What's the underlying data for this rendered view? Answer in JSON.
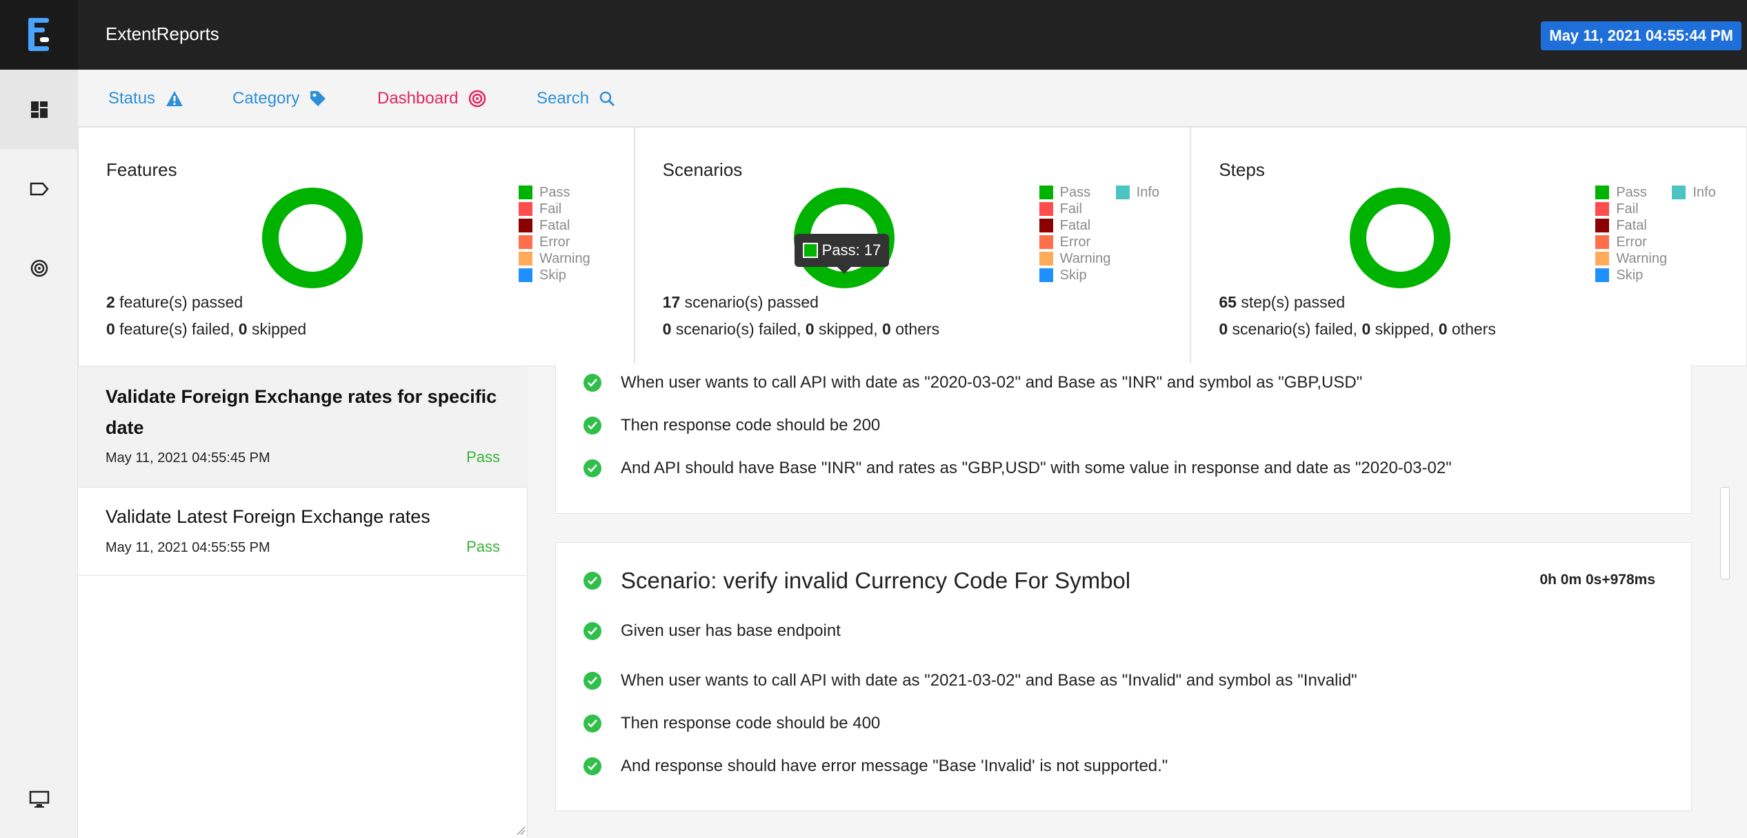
{
  "header": {
    "app_title": "ExtentReports",
    "timestamp": "May 11, 2021 04:55:44 PM",
    "logo_icon": "extent-logo-icon"
  },
  "sidebar": {
    "items": [
      {
        "icon": "dashboard-icon"
      },
      {
        "icon": "tag-icon"
      },
      {
        "icon": "target-icon"
      },
      {
        "icon": "monitor-icon"
      }
    ]
  },
  "nav": {
    "status": "Status",
    "category": "Category",
    "dashboard": "Dashboard",
    "search": "Search"
  },
  "legend_labels": {
    "pass": "Pass",
    "fail": "Fail",
    "fatal": "Fatal",
    "error": "Error",
    "warning": "Warning",
    "skip": "Skip",
    "info": "Info"
  },
  "colors": {
    "pass": "#00b300",
    "fail": "#ff4c4c",
    "fatal": "#8b0000",
    "error": "#ff6f4c",
    "warning": "#ffab59",
    "skip": "#1e90ff",
    "info": "#4cc4c4",
    "accent": "#1e6fd9",
    "status_pass_text": "#35b335"
  },
  "cards": {
    "features": {
      "title": "Features",
      "passed_count": "2",
      "passed_text": " feature(s) passed",
      "failed_count": "0",
      "failed_text": " feature(s) failed, ",
      "skipped_count": "0",
      "skipped_text": " skipped"
    },
    "scenarios": {
      "title": "Scenarios",
      "tooltip": "Pass: 17",
      "passed_count": "17",
      "passed_text": " scenario(s) passed",
      "failed_count": "0",
      "failed_text": " scenario(s) failed, ",
      "skipped_count": "0",
      "skipped_text": " skipped, ",
      "others_count": "0",
      "others_text": " others"
    },
    "steps": {
      "title": "Steps",
      "passed_count": "65",
      "passed_text": " step(s) passed",
      "failed_count": "0",
      "failed_text": " scenario(s) failed, ",
      "skipped_count": "0",
      "skipped_text": " skipped, ",
      "others_count": "0",
      "others_text": " others"
    }
  },
  "test_list": [
    {
      "title_line1": "Validate Foreign Exchange rates for specific",
      "title_line2": "date",
      "date": "May 11, 2021 04:55:45 PM",
      "status": "Pass"
    },
    {
      "title_line1": "Validate Latest Foreign Exchange rates",
      "date": "May 11, 2021 04:55:55 PM",
      "status": "Pass"
    }
  ],
  "detail": {
    "panel1_steps": [
      "When user wants to call API with date as \"2020-03-02\" and Base as \"INR\" and symbol as \"GBP,USD\"",
      "Then response code should be 200",
      "And API should have Base \"INR\" and rates as \"GBP,USD\" with some value in response and date as \"2020-03-02\""
    ],
    "panel2": {
      "scenario_title": "Scenario: verify invalid Currency Code For Symbol",
      "duration": "0h 0m 0s+978ms",
      "steps": [
        "Given user has base endpoint",
        "When user wants to call API with date as \"2021-03-02\" and Base as \"Invalid\" and symbol as \"Invalid\"",
        "Then response code should be 400",
        "And response should have error message \"Base 'Invalid' is not supported.\""
      ]
    }
  }
}
